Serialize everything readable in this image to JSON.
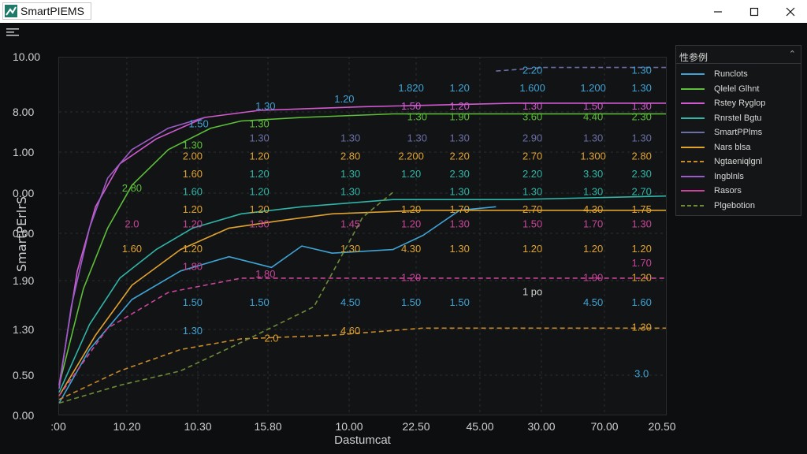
{
  "app": {
    "title": "SmartPIEMS"
  },
  "window_controls": {
    "minimize": "—",
    "maximize": "☐",
    "close": "✕"
  },
  "toolbar": {
    "menu_icon": "hamburger-icon"
  },
  "legend": {
    "title": "性参例",
    "chevron": "⌃",
    "items": [
      {
        "label": "Runclots",
        "color": "#3fa3d6",
        "dash": false
      },
      {
        "label": "Qlelel Glhnt",
        "color": "#5dbf3a",
        "dash": false
      },
      {
        "label": "Rstey Ryglop",
        "color": "#d25ad0",
        "dash": false
      },
      {
        "label": "Rnrstel Bgtu",
        "color": "#2fb6a8",
        "dash": false
      },
      {
        "label": "SmartPPlms",
        "color": "#6b6fa8",
        "dash": false
      },
      {
        "label": "Nars blsa",
        "color": "#e0a330",
        "dash": false
      },
      {
        "label": "Ngtaeniqlgnl",
        "color": "#c98a2c",
        "dash": true
      },
      {
        "label": "Ingblnls",
        "color": "#9a5cc8",
        "dash": false
      },
      {
        "label": "Rasors",
        "color": "#c9449a",
        "dash": false
      },
      {
        "label": "Plgebotion",
        "color": "#6f8b3a",
        "dash": true
      }
    ]
  },
  "axes": {
    "ylabel": "SmartPErlrS",
    "xlabel": "Dastumcat",
    "yticks": [
      "10.00",
      "8.00",
      "1.00",
      "0.00",
      "0.00",
      "1.90",
      "1.30",
      "0.50",
      "0.00"
    ],
    "xticks": [
      ":00",
      "10.20",
      "10.30",
      "15.80",
      "10.00",
      "22.50",
      "45.00",
      "30.00",
      "70.00",
      "20.50"
    ]
  },
  "chart_data": {
    "type": "line",
    "title": "",
    "xlabel": "Dastumcat",
    "ylabel": "SmartPErlrS",
    "grid": true,
    "legend_position": "right",
    "series": [
      {
        "name": "Runclots",
        "color": "#3fa3d6",
        "dash": false,
        "points": [
          [
            0,
            0.03
          ],
          [
            0.05,
            0.18
          ],
          [
            0.12,
            0.32
          ],
          [
            0.2,
            0.4
          ],
          [
            0.28,
            0.44
          ],
          [
            0.35,
            0.41
          ],
          [
            0.4,
            0.47
          ],
          [
            0.45,
            0.45
          ],
          [
            0.55,
            0.46
          ],
          [
            0.6,
            0.5
          ],
          [
            0.66,
            0.57
          ],
          [
            0.72,
            0.58
          ]
        ]
      },
      {
        "name": "Qlelel Glhnt",
        "color": "#5dbf3a",
        "dash": false,
        "points": [
          [
            0,
            0.08
          ],
          [
            0.04,
            0.35
          ],
          [
            0.08,
            0.52
          ],
          [
            0.12,
            0.64
          ],
          [
            0.18,
            0.74
          ],
          [
            0.25,
            0.8
          ],
          [
            0.3,
            0.82
          ],
          [
            0.4,
            0.83
          ],
          [
            0.55,
            0.84
          ],
          [
            1.0,
            0.84
          ]
        ]
      },
      {
        "name": "Rstey Ryglop",
        "color": "#d25ad0",
        "dash": false,
        "points": [
          [
            0,
            0.08
          ],
          [
            0.03,
            0.4
          ],
          [
            0.06,
            0.58
          ],
          [
            0.1,
            0.7
          ],
          [
            0.16,
            0.77
          ],
          [
            0.24,
            0.83
          ],
          [
            0.33,
            0.85
          ],
          [
            0.5,
            0.86
          ],
          [
            0.75,
            0.87
          ],
          [
            1.0,
            0.87
          ]
        ]
      },
      {
        "name": "Rnrstel Bgtu",
        "color": "#2fb6a8",
        "dash": false,
        "points": [
          [
            0,
            0.06
          ],
          [
            0.05,
            0.25
          ],
          [
            0.1,
            0.38
          ],
          [
            0.16,
            0.46
          ],
          [
            0.22,
            0.52
          ],
          [
            0.3,
            0.56
          ],
          [
            0.4,
            0.58
          ],
          [
            0.55,
            0.6
          ],
          [
            0.75,
            0.6
          ],
          [
            1.0,
            0.61
          ]
        ]
      },
      {
        "name": "Nars blsa",
        "color": "#e0a330",
        "dash": false,
        "points": [
          [
            0,
            0.05
          ],
          [
            0.06,
            0.22
          ],
          [
            0.12,
            0.36
          ],
          [
            0.2,
            0.46
          ],
          [
            0.28,
            0.52
          ],
          [
            0.36,
            0.54
          ],
          [
            0.45,
            0.56
          ],
          [
            0.6,
            0.57
          ],
          [
            0.8,
            0.57
          ],
          [
            1.0,
            0.57
          ]
        ]
      },
      {
        "name": "Ngtaeniqlgnl",
        "color": "#c98a2c",
        "dash": true,
        "points": [
          [
            0,
            0.04
          ],
          [
            0.1,
            0.12
          ],
          [
            0.2,
            0.18
          ],
          [
            0.3,
            0.21
          ],
          [
            0.45,
            0.22
          ],
          [
            0.6,
            0.24
          ],
          [
            0.8,
            0.24
          ],
          [
            1.0,
            0.24
          ]
        ]
      },
      {
        "name": "Ingblnls",
        "color": "#9a5cc8",
        "dash": false,
        "points": [
          [
            0,
            0.07
          ],
          [
            0.02,
            0.3
          ],
          [
            0.05,
            0.52
          ],
          [
            0.08,
            0.66
          ],
          [
            0.12,
            0.74
          ],
          [
            0.18,
            0.8
          ],
          [
            0.24,
            0.83
          ]
        ]
      },
      {
        "name": "Rasors",
        "color": "#c9449a",
        "dash": true,
        "points": [
          [
            0,
            0.05
          ],
          [
            0.08,
            0.24
          ],
          [
            0.18,
            0.34
          ],
          [
            0.3,
            0.38
          ],
          [
            0.45,
            0.38
          ],
          [
            0.6,
            0.38
          ],
          [
            0.8,
            0.38
          ],
          [
            1.0,
            0.38
          ]
        ]
      },
      {
        "name": "Plgebotion",
        "color": "#6f8b3a",
        "dash": true,
        "points": [
          [
            0,
            0.03
          ],
          [
            0.1,
            0.08
          ],
          [
            0.2,
            0.12
          ],
          [
            0.3,
            0.2
          ],
          [
            0.42,
            0.3
          ],
          [
            0.5,
            0.55
          ],
          [
            0.55,
            0.62
          ]
        ]
      },
      {
        "name": "SmartPPlms",
        "color": "#6b6fa8",
        "dash": true,
        "points": [
          [
            0.72,
            0.96
          ],
          [
            0.8,
            0.97
          ],
          [
            1.0,
            0.97
          ]
        ]
      }
    ],
    "value_labels": [
      {
        "text": "1.30",
        "color": "#3fa3d6",
        "x": 0.34,
        "y": 0.86
      },
      {
        "text": "1.20",
        "color": "#3fa3d6",
        "x": 0.47,
        "y": 0.88
      },
      {
        "text": "1.820",
        "color": "#3fa3d6",
        "x": 0.58,
        "y": 0.91
      },
      {
        "text": "1.20",
        "color": "#3fa3d6",
        "x": 0.66,
        "y": 0.91
      },
      {
        "text": "1.600",
        "color": "#3fa3d6",
        "x": 0.78,
        "y": 0.91
      },
      {
        "text": "1.200",
        "color": "#3fa3d6",
        "x": 0.88,
        "y": 0.91
      },
      {
        "text": "1.30",
        "color": "#3fa3d6",
        "x": 0.96,
        "y": 0.91
      },
      {
        "text": "2.20",
        "color": "#3fa3d6",
        "x": 0.78,
        "y": 0.96
      },
      {
        "text": "1.30",
        "color": "#3fa3d6",
        "x": 0.96,
        "y": 0.96
      },
      {
        "text": "1.50",
        "color": "#d25ad0",
        "x": 0.58,
        "y": 0.86
      },
      {
        "text": "1.20",
        "color": "#d25ad0",
        "x": 0.66,
        "y": 0.86
      },
      {
        "text": "1.30",
        "color": "#d25ad0",
        "x": 0.78,
        "y": 0.86
      },
      {
        "text": "1.50",
        "color": "#d25ad0",
        "x": 0.88,
        "y": 0.86
      },
      {
        "text": "1.30",
        "color": "#d25ad0",
        "x": 0.96,
        "y": 0.86
      },
      {
        "text": "1.30",
        "color": "#5dbf3a",
        "x": 0.33,
        "y": 0.81
      },
      {
        "text": "1.30",
        "color": "#5dbf3a",
        "x": 0.59,
        "y": 0.83
      },
      {
        "text": "1.90",
        "color": "#5dbf3a",
        "x": 0.66,
        "y": 0.83
      },
      {
        "text": "3.60",
        "color": "#5dbf3a",
        "x": 0.78,
        "y": 0.83
      },
      {
        "text": "4.40",
        "color": "#5dbf3a",
        "x": 0.88,
        "y": 0.83
      },
      {
        "text": "2.30",
        "color": "#5dbf3a",
        "x": 0.96,
        "y": 0.83
      },
      {
        "text": "1.50",
        "color": "#3fa3d6",
        "x": 0.23,
        "y": 0.81
      },
      {
        "text": "1.30",
        "color": "#6b6fa8",
        "x": 0.33,
        "y": 0.77
      },
      {
        "text": "1.30",
        "color": "#6b6fa8",
        "x": 0.48,
        "y": 0.77
      },
      {
        "text": "1.30",
        "color": "#6b6fa8",
        "x": 0.59,
        "y": 0.77
      },
      {
        "text": "1.30",
        "color": "#6b6fa8",
        "x": 0.66,
        "y": 0.77
      },
      {
        "text": "2.90",
        "color": "#6b6fa8",
        "x": 0.78,
        "y": 0.77
      },
      {
        "text": "1.30",
        "color": "#6b6fa8",
        "x": 0.88,
        "y": 0.77
      },
      {
        "text": "1.30",
        "color": "#6b6fa8",
        "x": 0.96,
        "y": 0.77
      },
      {
        "text": "1.30",
        "color": "#5dbf3a",
        "x": 0.22,
        "y": 0.75
      },
      {
        "text": "2.00",
        "color": "#e0a330",
        "x": 0.22,
        "y": 0.72
      },
      {
        "text": "1.20",
        "color": "#e0a330",
        "x": 0.33,
        "y": 0.72
      },
      {
        "text": "2.80",
        "color": "#e0a330",
        "x": 0.48,
        "y": 0.72
      },
      {
        "text": "2.200",
        "color": "#e0a330",
        "x": 0.58,
        "y": 0.72
      },
      {
        "text": "2.20",
        "color": "#e0a330",
        "x": 0.66,
        "y": 0.72
      },
      {
        "text": "2.70",
        "color": "#e0a330",
        "x": 0.78,
        "y": 0.72
      },
      {
        "text": "1.300",
        "color": "#e0a330",
        "x": 0.88,
        "y": 0.72
      },
      {
        "text": "2.80",
        "color": "#e0a330",
        "x": 0.96,
        "y": 0.72
      },
      {
        "text": "1.60",
        "color": "#e0a330",
        "x": 0.22,
        "y": 0.67
      },
      {
        "text": "1.20",
        "color": "#2fb6a8",
        "x": 0.33,
        "y": 0.67
      },
      {
        "text": "1.30",
        "color": "#2fb6a8",
        "x": 0.48,
        "y": 0.67
      },
      {
        "text": "1.20",
        "color": "#2fb6a8",
        "x": 0.58,
        "y": 0.67
      },
      {
        "text": "2.30",
        "color": "#2fb6a8",
        "x": 0.66,
        "y": 0.67
      },
      {
        "text": "2.20",
        "color": "#2fb6a8",
        "x": 0.78,
        "y": 0.67
      },
      {
        "text": "3.30",
        "color": "#2fb6a8",
        "x": 0.88,
        "y": 0.67
      },
      {
        "text": "2.30",
        "color": "#2fb6a8",
        "x": 0.96,
        "y": 0.67
      },
      {
        "text": "2.80",
        "color": "#5dbf3a",
        "x": 0.12,
        "y": 0.63
      },
      {
        "text": "1.60",
        "color": "#2fb6a8",
        "x": 0.22,
        "y": 0.62
      },
      {
        "text": "1.20",
        "color": "#2fb6a8",
        "x": 0.33,
        "y": 0.62
      },
      {
        "text": "1.30",
        "color": "#2fb6a8",
        "x": 0.48,
        "y": 0.62
      },
      {
        "text": "1.30",
        "color": "#2fb6a8",
        "x": 0.66,
        "y": 0.62
      },
      {
        "text": "1.30",
        "color": "#2fb6a8",
        "x": 0.78,
        "y": 0.62
      },
      {
        "text": "1.30",
        "color": "#2fb6a8",
        "x": 0.88,
        "y": 0.62
      },
      {
        "text": "2.70",
        "color": "#2fb6a8",
        "x": 0.96,
        "y": 0.62
      },
      {
        "text": "1.20",
        "color": "#e0a330",
        "x": 0.22,
        "y": 0.57
      },
      {
        "text": "1.20",
        "color": "#e0a330",
        "x": 0.33,
        "y": 0.57
      },
      {
        "text": "1.20",
        "color": "#e0a330",
        "x": 0.58,
        "y": 0.57
      },
      {
        "text": "1.70",
        "color": "#e0a330",
        "x": 0.66,
        "y": 0.57
      },
      {
        "text": "2.70",
        "color": "#e0a330",
        "x": 0.78,
        "y": 0.57
      },
      {
        "text": "4.30",
        "color": "#e0a330",
        "x": 0.88,
        "y": 0.57
      },
      {
        "text": "1.75",
        "color": "#e0a330",
        "x": 0.96,
        "y": 0.57
      },
      {
        "text": "2.0",
        "color": "#c9449a",
        "x": 0.12,
        "y": 0.53
      },
      {
        "text": "1.20",
        "color": "#c9449a",
        "x": 0.22,
        "y": 0.53
      },
      {
        "text": "1.30",
        "color": "#c9449a",
        "x": 0.33,
        "y": 0.53
      },
      {
        "text": "1.45",
        "color": "#c9449a",
        "x": 0.48,
        "y": 0.53
      },
      {
        "text": "1.20",
        "color": "#c9449a",
        "x": 0.58,
        "y": 0.53
      },
      {
        "text": "1.30",
        "color": "#c9449a",
        "x": 0.66,
        "y": 0.53
      },
      {
        "text": "1.50",
        "color": "#c9449a",
        "x": 0.78,
        "y": 0.53
      },
      {
        "text": "1.70",
        "color": "#c9449a",
        "x": 0.88,
        "y": 0.53
      },
      {
        "text": "1.30",
        "color": "#c9449a",
        "x": 0.96,
        "y": 0.53
      },
      {
        "text": "1.60",
        "color": "#e0a330",
        "x": 0.12,
        "y": 0.46
      },
      {
        "text": "1.20",
        "color": "#e0a330",
        "x": 0.22,
        "y": 0.46
      },
      {
        "text": "1.30",
        "color": "#e0a330",
        "x": 0.48,
        "y": 0.46
      },
      {
        "text": "4.30",
        "color": "#e0a330",
        "x": 0.58,
        "y": 0.46
      },
      {
        "text": "1.30",
        "color": "#e0a330",
        "x": 0.66,
        "y": 0.46
      },
      {
        "text": "1.20",
        "color": "#e0a330",
        "x": 0.78,
        "y": 0.46
      },
      {
        "text": "1.20",
        "color": "#e0a330",
        "x": 0.88,
        "y": 0.46
      },
      {
        "text": "1.20",
        "color": "#e0a330",
        "x": 0.96,
        "y": 0.46
      },
      {
        "text": "1.80",
        "color": "#c9449a",
        "x": 0.22,
        "y": 0.41
      },
      {
        "text": "1.70",
        "color": "#c9449a",
        "x": 0.96,
        "y": 0.42
      },
      {
        "text": "1.80",
        "color": "#c9449a",
        "x": 0.34,
        "y": 0.39
      },
      {
        "text": "1.20",
        "color": "#c9449a",
        "x": 0.58,
        "y": 0.38
      },
      {
        "text": "1.90",
        "color": "#c9449a",
        "x": 0.88,
        "y": 0.38
      },
      {
        "text": "1.20",
        "color": "#e0a330",
        "x": 0.96,
        "y": 0.38
      },
      {
        "text": "1.50",
        "color": "#3fa3d6",
        "x": 0.33,
        "y": 0.31
      },
      {
        "text": "4.50",
        "color": "#3fa3d6",
        "x": 0.48,
        "y": 0.31
      },
      {
        "text": "1.50",
        "color": "#3fa3d6",
        "x": 0.58,
        "y": 0.31
      },
      {
        "text": "1.50",
        "color": "#3fa3d6",
        "x": 0.66,
        "y": 0.31
      },
      {
        "text": "4.50",
        "color": "#3fa3d6",
        "x": 0.88,
        "y": 0.31
      },
      {
        "text": "1.60",
        "color": "#3fa3d6",
        "x": 0.96,
        "y": 0.31
      },
      {
        "text": "1.50",
        "color": "#3fa3d6",
        "x": 0.22,
        "y": 0.31
      },
      {
        "text": "1 po",
        "color": "#cfcfcf",
        "x": 0.78,
        "y": 0.34
      },
      {
        "text": "1.30",
        "color": "#3fa3d6",
        "x": 0.22,
        "y": 0.23
      },
      {
        "text": "4.60",
        "color": "#e0a330",
        "x": 0.48,
        "y": 0.23
      },
      {
        "text": "1.30",
        "color": "#e0a330",
        "x": 0.96,
        "y": 0.24
      },
      {
        "text": "2.0",
        "color": "#e0a330",
        "x": 0.35,
        "y": 0.21
      },
      {
        "text": "3.0",
        "color": "#3fa3d6",
        "x": 0.96,
        "y": 0.11
      }
    ]
  }
}
